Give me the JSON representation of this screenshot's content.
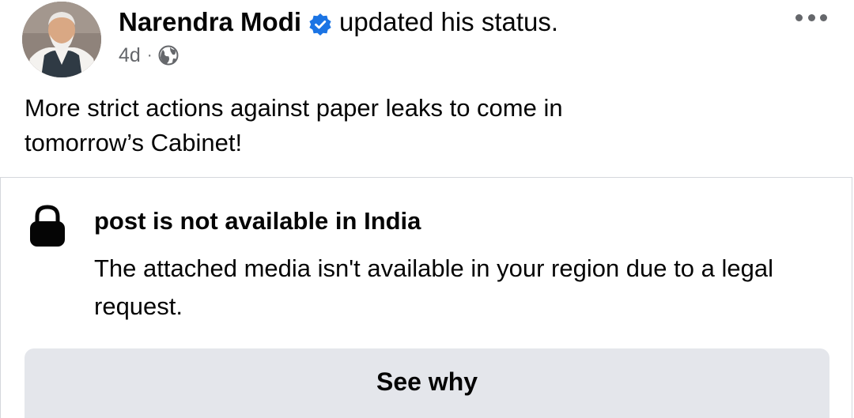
{
  "post": {
    "author": "Narendra Modi",
    "status_action": "updated his status.",
    "timestamp": "4d",
    "meta_separator": "·",
    "audience_icon": "globe-icon",
    "verified_icon": "verified-badge-icon",
    "more_icon": "more-options-icon",
    "text_line1": "More strict actions against paper leaks to come in",
    "text_line2": "tomorrow’s Cabinet!"
  },
  "notice": {
    "icon": "lock-icon",
    "title": "post is not available in India",
    "body": "The attached media isn't available in your region due to a legal request.",
    "button_label": "See why"
  },
  "colors": {
    "verified_blue": "#1b74e4",
    "secondary_text": "#65676b",
    "button_background": "#e4e6eb",
    "card_border": "#d5d7dc"
  }
}
